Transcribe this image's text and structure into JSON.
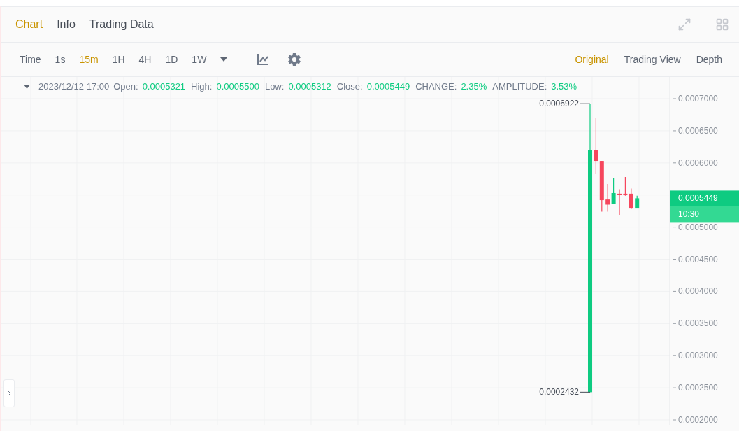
{
  "tabs": [
    {
      "label": "Chart",
      "selected": true
    },
    {
      "label": "Info",
      "selected": false
    },
    {
      "label": "Trading Data",
      "selected": false
    }
  ],
  "intervals": [
    {
      "label": "Time",
      "selected": false
    },
    {
      "label": "1s",
      "selected": false
    },
    {
      "label": "15m",
      "selected": true
    },
    {
      "label": "1H",
      "selected": false
    },
    {
      "label": "4H",
      "selected": false
    },
    {
      "label": "1D",
      "selected": false
    },
    {
      "label": "1W",
      "selected": false
    }
  ],
  "view_modes": [
    {
      "label": "Original",
      "selected": true
    },
    {
      "label": "Trading View",
      "selected": false
    },
    {
      "label": "Depth",
      "selected": false
    }
  ],
  "ohlc_bar": {
    "date": "2023/12/12 17:00",
    "fields": [
      {
        "label": "Open:",
        "value": "0.0005321"
      },
      {
        "label": "High:",
        "value": "0.0005500"
      },
      {
        "label": "Low:",
        "value": "0.0005312"
      },
      {
        "label": "Close:",
        "value": "0.0005449"
      },
      {
        "label": "CHANGE:",
        "value": "2.35%"
      },
      {
        "label": "AMPLITUDE:",
        "value": "3.53%"
      }
    ]
  },
  "chart": {
    "high_label": "0.0006922",
    "low_label": "0.0002432",
    "last_price": "0.0005449",
    "countdown": "10:30",
    "chart_data": {
      "type": "candlestick",
      "ylim": [
        0.0001913,
        0.0007338
      ],
      "grid": true,
      "categories": [
        null,
        null,
        null,
        null,
        null,
        null,
        null,
        null,
        null
      ],
      "yticks": [
        {
          "value": 0.0007,
          "label": "0.0007000"
        },
        {
          "value": 0.00065,
          "label": "0.0006500"
        },
        {
          "value": 0.0006,
          "label": "0.0006000"
        },
        {
          "value": 0.0005,
          "label": "0.0005000"
        },
        {
          "value": 0.00045,
          "label": "0.0004500"
        },
        {
          "value": 0.0004,
          "label": "0.0004000"
        },
        {
          "value": 0.00035,
          "label": "0.0003500"
        },
        {
          "value": 0.0003,
          "label": "0.0003000"
        },
        {
          "value": 0.00025,
          "label": "0.0002500"
        },
        {
          "value": 0.0002,
          "label": "0.0002000"
        }
      ],
      "series": [
        {
          "ohlc": [
            [
              0.0002432,
              0.0006922,
              0.0002432,
              0.00062
            ],
            [
              0.00062,
              0.00067,
              0.000583,
              0.000603
            ],
            [
              0.000603,
              0.000603,
              0.000524,
              0.000542
            ],
            [
              0.000543,
              0.000567,
              0.000524,
              0.000535
            ],
            [
              0.000536,
              0.000577,
              0.000536,
              0.000553
            ],
            [
              0.000552,
              0.000559,
              0.000518,
              0.00055
            ],
            [
              0.000552,
              0.000578,
              0.000549,
              0.00055
            ],
            [
              0.000552,
              0.00056,
              0.000529,
              0.00053
            ],
            [
              0.00053,
              0.000549,
              0.00053,
              0.0005449
            ]
          ]
        }
      ]
    }
  }
}
